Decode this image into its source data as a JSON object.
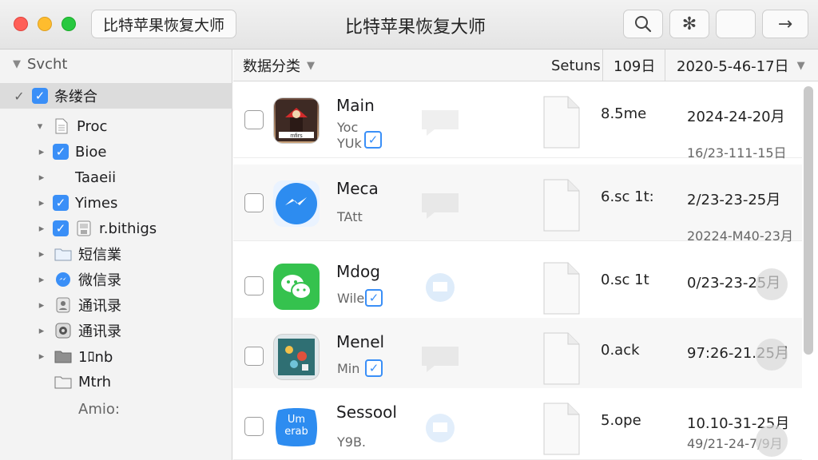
{
  "window": {
    "title": "比特苹果恢复大师",
    "left_button": "比特苹果恢复大师"
  },
  "sidebar": {
    "search_label": "Svcht",
    "items": [
      {
        "label": "条缕合",
        "disclosure": "open",
        "checked": true,
        "icon": "none"
      },
      {
        "label": "Proc",
        "disclosure": "open",
        "checked": false,
        "icon": "document-icon"
      },
      {
        "label": "Bioe",
        "disclosure": "closed",
        "checked": true,
        "icon": "none"
      },
      {
        "label": "Taaeii",
        "disclosure": "closed",
        "checked": false,
        "icon": "none"
      },
      {
        "label": "Yimes",
        "disclosure": "closed",
        "checked": true,
        "icon": "none"
      },
      {
        "label": "r.bithigs",
        "disclosure": "closed",
        "checked": true,
        "icon": "drive-icon"
      },
      {
        "label": "短信業",
        "disclosure": "closed",
        "checked": false,
        "icon": "folder-icon"
      },
      {
        "label": "微信录",
        "disclosure": "closed",
        "checked": false,
        "icon": "messenger-icon"
      },
      {
        "label": "通讯录",
        "disclosure": "closed",
        "checked": false,
        "icon": "contacts-icon"
      },
      {
        "label": "通讯录",
        "disclosure": "closed",
        "checked": false,
        "icon": "camera-icon"
      },
      {
        "label": "1ﾛnb",
        "disclosure": "closed",
        "checked": false,
        "icon": "folder-dark-icon"
      },
      {
        "label": "Mtrh",
        "disclosure": "none",
        "checked": false,
        "icon": "folder-outline-icon"
      },
      {
        "label": "Amio:",
        "disclosure": "none",
        "checked": false,
        "icon": "none"
      }
    ]
  },
  "columns": {
    "category": "数据分类",
    "size": "Setuns",
    "count": "109日",
    "date": "2020-5-46-17日"
  },
  "rows": [
    {
      "name": "Main",
      "sub": "Yoc",
      "sub2": "YUk",
      "size": "8.5me",
      "date": "2024-24-20月",
      "date2": "16/23-111-15日",
      "app": "photo-app-icon",
      "checked_mini": true,
      "dot": false
    },
    {
      "name": "Meca",
      "sub": "TAtt",
      "sub2": "",
      "size": "6.sc 1t:",
      "date": "2/23-23-25月",
      "date2": "20224-M40-23月",
      "app": "messenger-app-icon",
      "checked_mini": false,
      "dot": false
    },
    {
      "name": "Mdog",
      "sub": "Wile",
      "sub2": "",
      "size": "0.sc 1t",
      "date": "0/23-23-25月",
      "date2": "",
      "app": "wechat-app-icon",
      "checked_mini": true,
      "dot": true
    },
    {
      "name": "Menel",
      "sub": "Min",
      "sub2": "",
      "size": "0.ack",
      "date": "97:26-21.25月",
      "date2": "",
      "app": "game-app-icon",
      "checked_mini": true,
      "dot": true
    },
    {
      "name": "Sessool",
      "sub": "Y9B.",
      "sub2": "",
      "size": "5.ope",
      "date": "10.10-31-25月",
      "date2": "49/21-24-7/9月",
      "app": "badge-app-icon",
      "checked_mini": false,
      "dot": true
    }
  ],
  "badge_text": {
    "line1": "Um",
    "line2": "erab"
  },
  "colors": {
    "accent": "#3a8ff7",
    "wechat": "#35c24e",
    "messenger": "#2d8cf0"
  }
}
